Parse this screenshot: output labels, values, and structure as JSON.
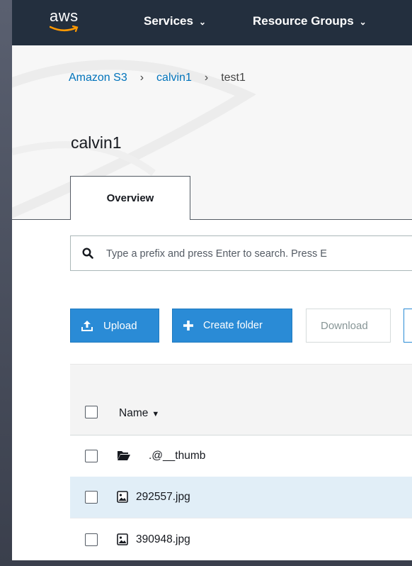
{
  "nav": {
    "logo": "aws",
    "items": [
      {
        "label": "Services",
        "icon": "chevron-down-icon"
      },
      {
        "label": "Resource Groups",
        "icon": "chevron-down-icon"
      }
    ]
  },
  "breadcrumb": [
    "Amazon S3",
    "calvin1",
    "test1"
  ],
  "bucket": {
    "title": "calvin1"
  },
  "tabs": [
    {
      "label": "Overview",
      "active": true
    }
  ],
  "search": {
    "placeholder": "Type a prefix and press Enter to search. Press E"
  },
  "actions": {
    "upload": "Upload",
    "create_folder": "Create folder",
    "download": "Download"
  },
  "table": {
    "header": {
      "name": "Name"
    },
    "rows": [
      {
        "name": ".@__thumb",
        "type": "folder",
        "selected": false
      },
      {
        "name": "292557.jpg",
        "type": "image",
        "selected": false
      },
      {
        "name": "390948.jpg",
        "type": "image",
        "selected": false
      }
    ]
  },
  "colors": {
    "nav_bg": "#232f3e",
    "link": "#0073bb",
    "primary_button": "#2a8bd6",
    "row_highlight": "#e1eef7"
  }
}
